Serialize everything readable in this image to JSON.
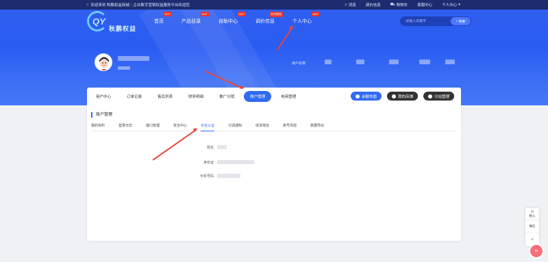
{
  "topbar": {
    "breadcrumb": "欢迎来到 秋鹏权益商城｜企业数字营销权益服务平台欢迎您",
    "links": [
      "消息",
      "调价信息",
      "购物车",
      "客服中心",
      "个人中心"
    ]
  },
  "logo": {
    "name": "秋鹏权益",
    "mark": "QY"
  },
  "mainnav": [
    {
      "label": "首页",
      "badge": "HOT"
    },
    {
      "label": "产品目录",
      "badge": "HOT"
    },
    {
      "label": "自助中心",
      "badge": "HOT"
    },
    {
      "label": "调价信息",
      "badge": "实时更新"
    },
    {
      "label": "个人中心",
      "badge": "HOT"
    }
  ],
  "search": {
    "placeholder": "请输入关键字",
    "button": "搜索"
  },
  "user": {
    "code_label": "用户名称"
  },
  "subnav": {
    "items": [
      "用户中心",
      "订单记录",
      "售后列表",
      "财务明细",
      "推广分销",
      "账户管理",
      "电商管理"
    ],
    "active": "账户管理",
    "buttons": [
      {
        "label": "余额充值",
        "color": "#2f6bf5"
      },
      {
        "label": "我的店铺",
        "color": "#333333"
      },
      {
        "label": "分站管理",
        "color": "#333333"
      }
    ]
  },
  "section": {
    "title": "账户管理",
    "tabs": [
      "我的资料",
      "登录日志",
      "接口管理",
      "安全中心",
      "实名认证",
      "订阅通知",
      "收货地址",
      "账号风控",
      "数据导出"
    ],
    "active_tab": "实名认证"
  },
  "form": {
    "name_label": "姓名",
    "id_label": "身份证",
    "phone_label": "手机号码"
  },
  "side": {
    "items": [
      "接入",
      "微信"
    ]
  },
  "colors": {
    "accent": "#2f6bf5",
    "hero": "#2a5cf2",
    "arrow": "#e8473a"
  }
}
